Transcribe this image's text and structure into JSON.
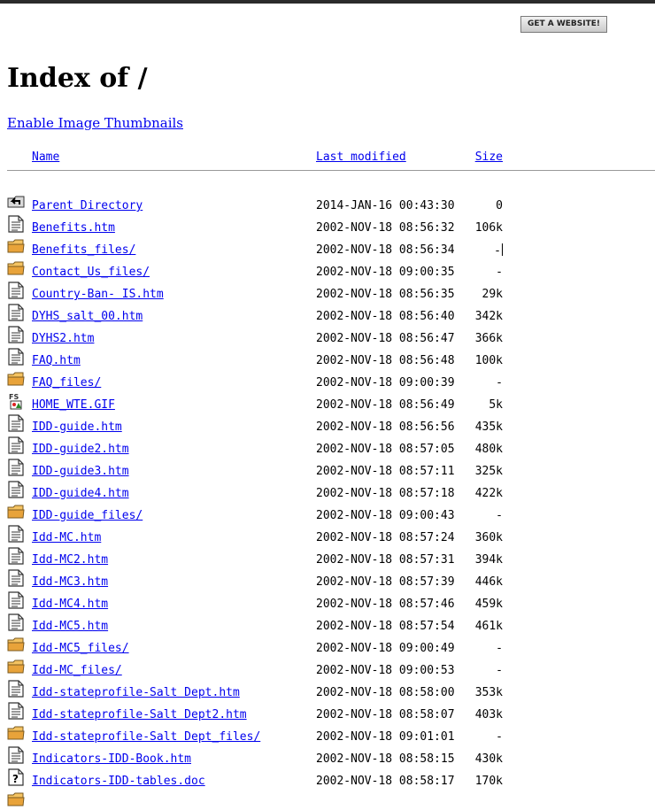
{
  "banner": {
    "button_label": "GET A WEBSITE!"
  },
  "page": {
    "title": "Index of /"
  },
  "thumbnails_link": "Enable Image Thumbnails",
  "columns": {
    "name": "Name",
    "modified": "Last modified",
    "size": "Size"
  },
  "entries": [
    {
      "name": "Parent Directory",
      "modified": "2014-JAN-16 00:43:30",
      "size": "0",
      "icon": "back-icon"
    },
    {
      "name": "Benefits.htm",
      "modified": "2002-NOV-18 08:56:32",
      "size": "106k",
      "icon": "text-file-icon"
    },
    {
      "name": "Benefits_files/",
      "modified": "2002-NOV-18 08:56:34",
      "size": "-",
      "icon": "folder-icon"
    },
    {
      "name": "Contact_Us_files/",
      "modified": "2002-NOV-18 09:00:35",
      "size": "-",
      "icon": "folder-icon"
    },
    {
      "name": "Country-Ban- IS.htm",
      "modified": "2002-NOV-18 08:56:35",
      "size": "29k",
      "icon": "text-file-icon"
    },
    {
      "name": "DYHS_salt_00.htm",
      "modified": "2002-NOV-18 08:56:40",
      "size": "342k",
      "icon": "text-file-icon"
    },
    {
      "name": "DYHS2.htm",
      "modified": "2002-NOV-18 08:56:47",
      "size": "366k",
      "icon": "text-file-icon"
    },
    {
      "name": "FAQ.htm",
      "modified": "2002-NOV-18 08:56:48",
      "size": "100k",
      "icon": "text-file-icon"
    },
    {
      "name": "FAQ_files/",
      "modified": "2002-NOV-18 09:00:39",
      "size": "-",
      "icon": "folder-icon"
    },
    {
      "name": "HOME_WTE.GIF",
      "modified": "2002-NOV-18 08:56:49",
      "size": "5k",
      "icon": "image-file-icon"
    },
    {
      "name": "IDD-guide.htm",
      "modified": "2002-NOV-18 08:56:56",
      "size": "435k",
      "icon": "text-file-icon"
    },
    {
      "name": "IDD-guide2.htm",
      "modified": "2002-NOV-18 08:57:05",
      "size": "480k",
      "icon": "text-file-icon"
    },
    {
      "name": "IDD-guide3.htm",
      "modified": "2002-NOV-18 08:57:11",
      "size": "325k",
      "icon": "text-file-icon"
    },
    {
      "name": "IDD-guide4.htm",
      "modified": "2002-NOV-18 08:57:18",
      "size": "422k",
      "icon": "text-file-icon"
    },
    {
      "name": "IDD-guide_files/",
      "modified": "2002-NOV-18 09:00:43",
      "size": "-",
      "icon": "folder-icon"
    },
    {
      "name": "Idd-MC.htm",
      "modified": "2002-NOV-18 08:57:24",
      "size": "360k",
      "icon": "text-file-icon"
    },
    {
      "name": "Idd-MC2.htm",
      "modified": "2002-NOV-18 08:57:31",
      "size": "394k",
      "icon": "text-file-icon"
    },
    {
      "name": "Idd-MC3.htm",
      "modified": "2002-NOV-18 08:57:39",
      "size": "446k",
      "icon": "text-file-icon"
    },
    {
      "name": "Idd-MC4.htm",
      "modified": "2002-NOV-18 08:57:46",
      "size": "459k",
      "icon": "text-file-icon"
    },
    {
      "name": "Idd-MC5.htm",
      "modified": "2002-NOV-18 08:57:54",
      "size": "461k",
      "icon": "text-file-icon"
    },
    {
      "name": "Idd-MC5_files/",
      "modified": "2002-NOV-18 09:00:49",
      "size": "-",
      "icon": "folder-icon"
    },
    {
      "name": "Idd-MC_files/",
      "modified": "2002-NOV-18 09:00:53",
      "size": "-",
      "icon": "folder-icon"
    },
    {
      "name": "Idd-stateprofile-Salt Dept.htm",
      "modified": "2002-NOV-18 08:58:00",
      "size": "353k",
      "icon": "text-file-icon"
    },
    {
      "name": "Idd-stateprofile-Salt Dept2.htm",
      "modified": "2002-NOV-18 08:58:07",
      "size": "403k",
      "icon": "text-file-icon"
    },
    {
      "name": "Idd-stateprofile-Salt Dept_files/",
      "modified": "2002-NOV-18 09:01:01",
      "size": "-",
      "icon": "folder-icon"
    },
    {
      "name": "Indicators-IDD-Book.htm",
      "modified": "2002-NOV-18 08:58:15",
      "size": "430k",
      "icon": "text-file-icon"
    },
    {
      "name": "Indicators-IDD-tables.doc",
      "modified": "2002-NOV-18 08:58:17",
      "size": "170k",
      "icon": "unknown-file-icon"
    },
    {
      "name": "",
      "modified": "",
      "size": "",
      "icon": "folder-icon"
    }
  ],
  "colors": {
    "link": "#0000ee",
    "folder": "#e8a33a",
    "topbar": "#2b2b2b"
  }
}
